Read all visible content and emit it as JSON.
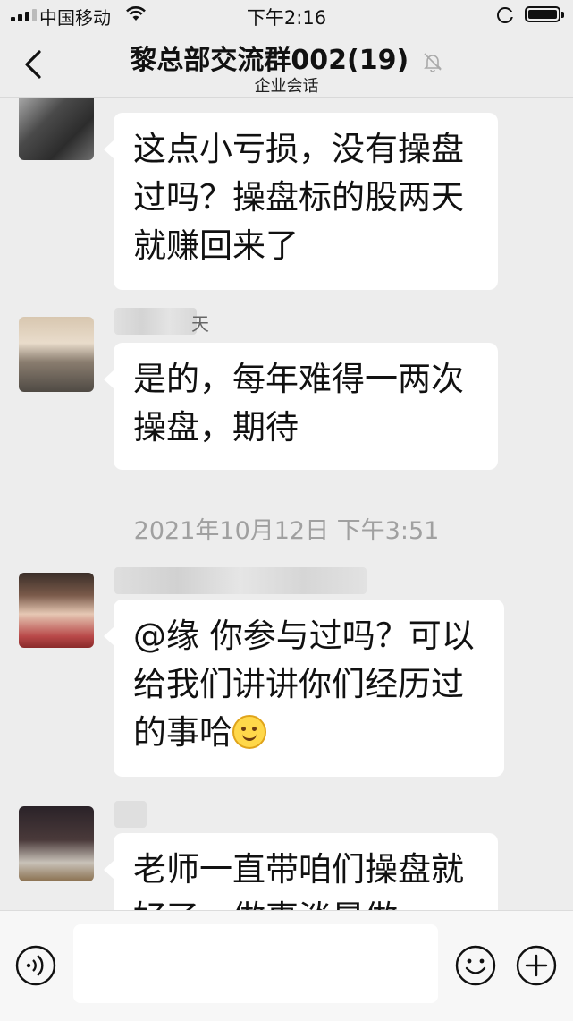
{
  "status_bar": {
    "carrier": "中国移动",
    "time": "下午2:16"
  },
  "header": {
    "title": "黎总部交流群002(19)",
    "subtitle": "企业会话"
  },
  "messages": [
    {
      "type": "text",
      "name": "",
      "text": "这点小亏损，没有操盘过吗？操盘标的股两天就赚回来了"
    },
    {
      "type": "text",
      "name": "天",
      "text": "是的，每年难得一两次操盘，期待"
    },
    {
      "type": "timestamp",
      "text": "2021年10月12日 下午3:51"
    },
    {
      "type": "text",
      "name": "",
      "text": "@缘 你参与过吗？可以给我们讲讲你们经历过的事哈",
      "emoji": "smile-emoji"
    },
    {
      "type": "text",
      "name": "",
      "text": "老师一直带咱们操盘就好了，做事淡是做"
    }
  ],
  "input_bar": {
    "voice_icon": "voice-icon",
    "emoji_icon": "emoji-icon",
    "plus_icon": "plus-icon"
  }
}
